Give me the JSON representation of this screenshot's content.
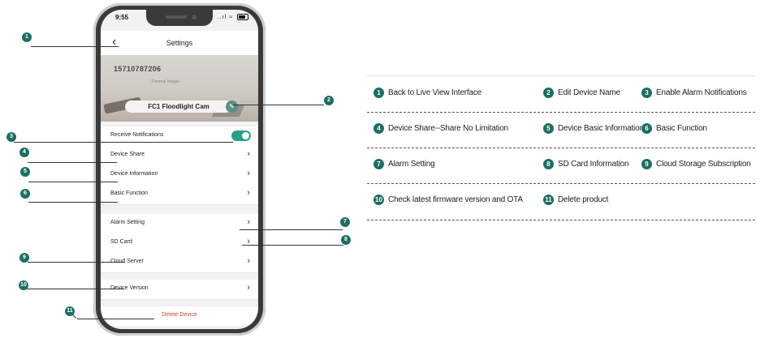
{
  "status_bar": {
    "time": "9:55",
    "signal": "..ıl ≈"
  },
  "nav": {
    "back_glyph": "‹",
    "title": "Settings"
  },
  "device": {
    "id": "15710787206",
    "subtitle": "Thermal Imager",
    "name": "FC1 Floodlight Cam",
    "edit_glyph": "✎"
  },
  "settings_rows": [
    {
      "label": "Receive Notifications",
      "type": "toggle",
      "enabled": true
    },
    {
      "label": "Device Share",
      "type": "chevron"
    },
    {
      "label": "Device Information",
      "type": "chevron"
    },
    {
      "label": "Basic Function",
      "type": "chevron"
    },
    {
      "label": "Alarm Setting",
      "type": "chevron"
    },
    {
      "label": "SD Card",
      "type": "chevron"
    },
    {
      "label": "Cloud Server",
      "type": "chevron"
    },
    {
      "label": "Device Version",
      "type": "chevron"
    }
  ],
  "chevron_glyph": "›",
  "delete_label": "Delete Device",
  "markers": [
    "1",
    "2",
    "3",
    "4",
    "5",
    "6",
    "7",
    "8",
    "9",
    "10",
    "11"
  ],
  "legend": [
    {
      "num": "1",
      "text": "Back to Live View Interface"
    },
    {
      "num": "2",
      "text": "Edit Device Name"
    },
    {
      "num": "3",
      "text": "Enable Alarm Notifications"
    },
    {
      "num": "4",
      "text": "Device Share--Share No Limitation"
    },
    {
      "num": "5",
      "text": "Device Basic Information"
    },
    {
      "num": "6",
      "text": "Basic Function"
    },
    {
      "num": "7",
      "text": "Alarm Setting"
    },
    {
      "num": "8",
      "text": "SD Card Information"
    },
    {
      "num": "9",
      "text": "Cloud Storage Subscription"
    },
    {
      "num": "10",
      "text": "Check latest firmware version and OTA"
    },
    {
      "num": "11",
      "text": "Delete product"
    }
  ],
  "colors": {
    "accent": "#1f6d63",
    "toggle_on": "#2e9d8a",
    "delete_red": "#d9442d"
  }
}
